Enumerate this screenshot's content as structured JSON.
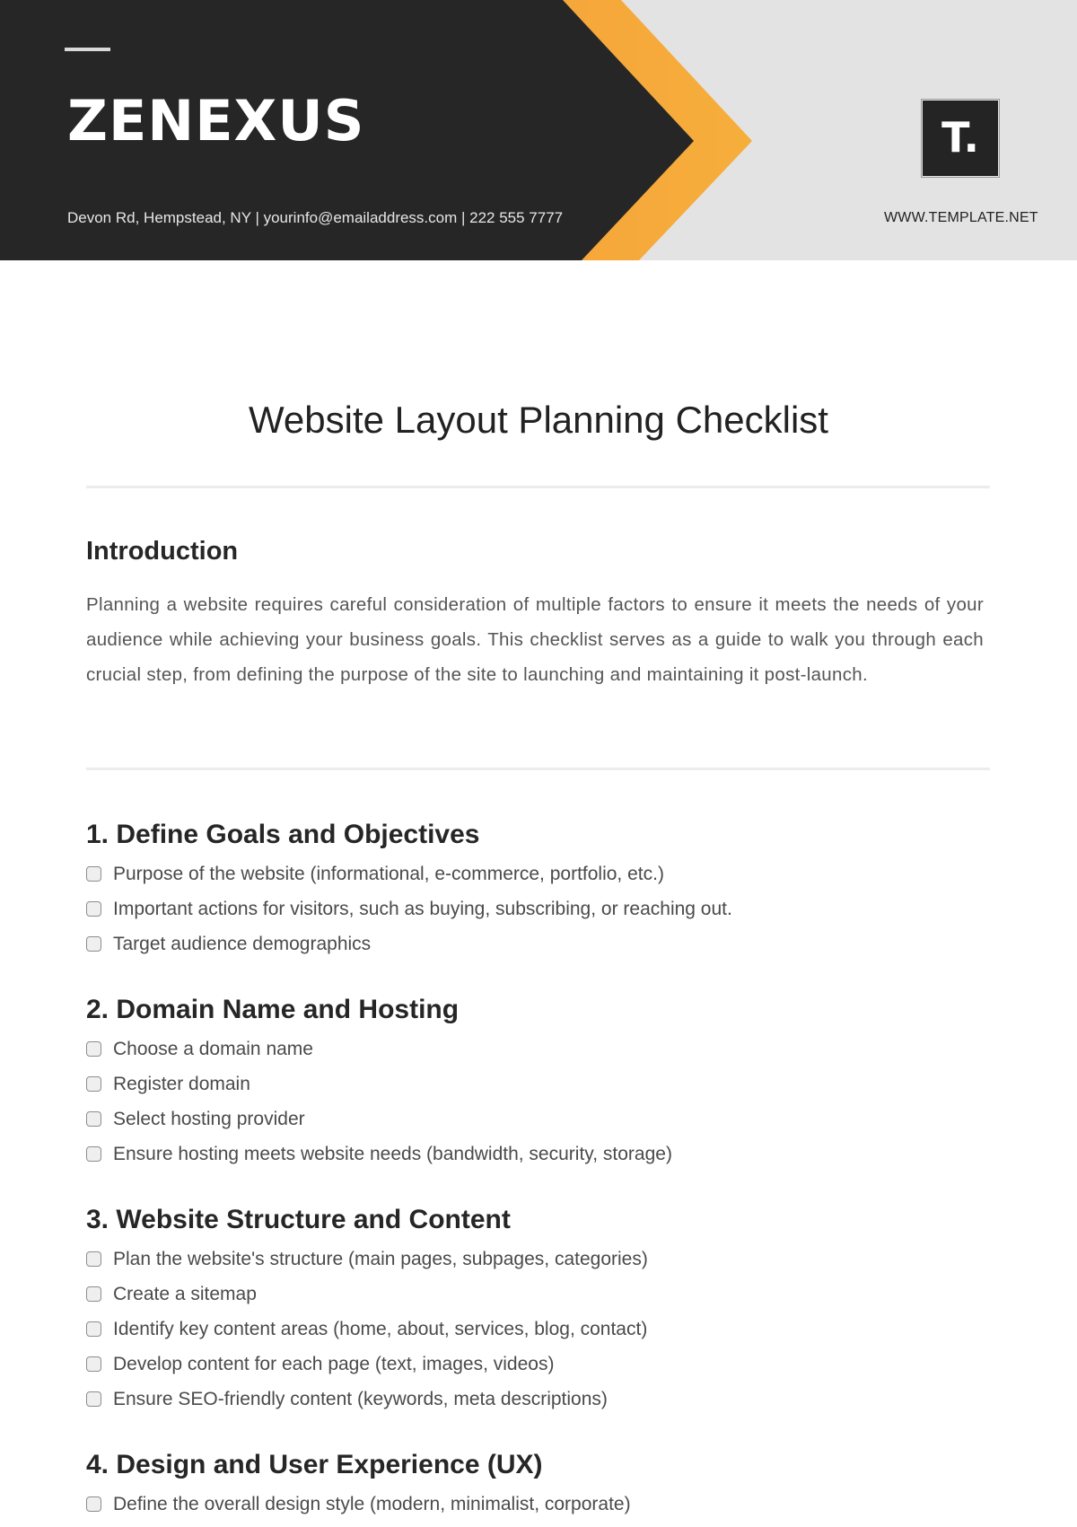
{
  "header": {
    "brand": "ZENEXUS",
    "contact": "Devon Rd, Hempstead, NY | yourinfo@emailaddress.com | 222 555 7777",
    "logo_letter": "T.",
    "logo_icon": "template-logo-icon",
    "site_url": "WWW.TEMPLATE.NET",
    "colors": {
      "dark": "#262626",
      "orange_start": "#f7903a",
      "orange_end": "#f6ae3b",
      "light": "#e3e3e3"
    }
  },
  "document": {
    "title": "Website Layout Planning Checklist",
    "intro": {
      "heading": "Introduction",
      "text": "Planning a website requires careful consideration of multiple factors to ensure it meets the needs of your audience while achieving your business goals. This checklist serves as a guide to walk you through each crucial step, from defining the purpose of the site to launching and maintaining it post-launch."
    },
    "sections": [
      {
        "heading": "1. Define Goals and Objectives",
        "items": [
          {
            "label": "Purpose of the website (informational, e-commerce, portfolio, etc.)",
            "checked": false
          },
          {
            "label": "Important actions for visitors, such as buying, subscribing, or reaching out.",
            "checked": false
          },
          {
            "label": "Target audience demographics",
            "checked": false
          }
        ]
      },
      {
        "heading": "2. Domain Name and Hosting",
        "items": [
          {
            "label": "Choose a domain name",
            "checked": false
          },
          {
            "label": "Register domain",
            "checked": false
          },
          {
            "label": "Select hosting provider",
            "checked": false
          },
          {
            "label": "Ensure hosting meets website needs (bandwidth, security, storage)",
            "checked": false
          }
        ]
      },
      {
        "heading": "3. Website Structure and Content",
        "items": [
          {
            "label": "Plan the website's structure (main pages, subpages, categories)",
            "checked": false
          },
          {
            "label": "Create a sitemap",
            "checked": false
          },
          {
            "label": "Identify key content areas (home, about, services, blog, contact)",
            "checked": false
          },
          {
            "label": "Develop content for each page (text, images, videos)",
            "checked": false
          },
          {
            "label": "Ensure SEO-friendly content (keywords, meta descriptions)",
            "checked": false
          }
        ]
      },
      {
        "heading": "4. Design and User Experience (UX)",
        "items": [
          {
            "label": "Define the overall design style (modern, minimalist, corporate)",
            "checked": false
          }
        ]
      }
    ]
  }
}
